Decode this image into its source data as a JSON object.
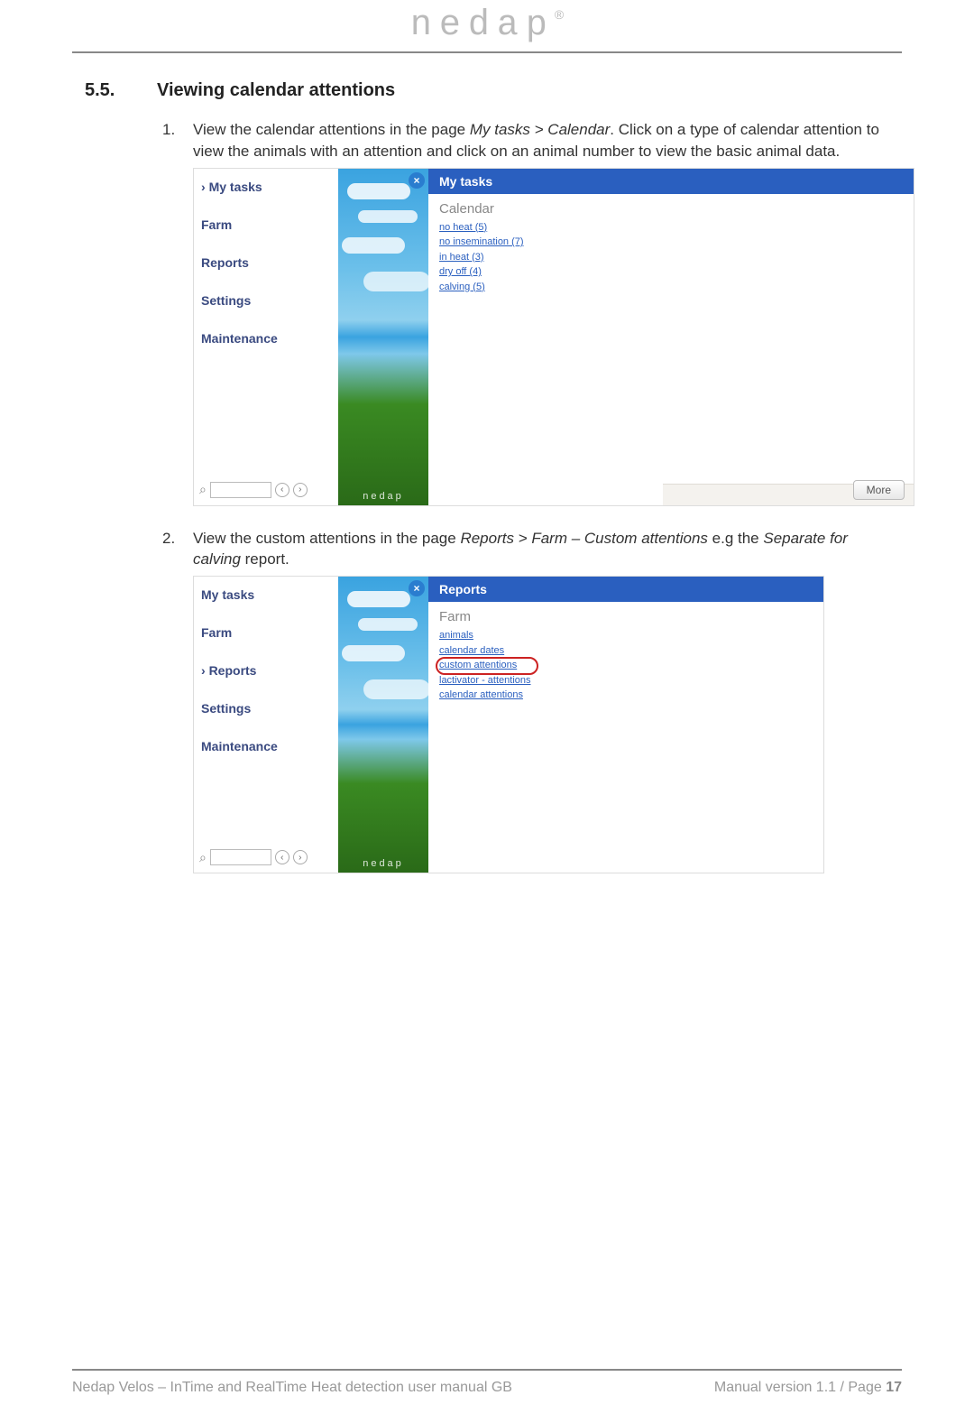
{
  "header": {
    "brand": "nedap",
    "registered": "®"
  },
  "section": {
    "number": "5.5.",
    "title": "Viewing calendar attentions"
  },
  "step1": {
    "number": "1.",
    "pre": "View the calendar attentions in the page ",
    "italic": "My tasks > Calendar",
    "post": ". Click on a type of calendar attention to view the animals with an attention and click on an animal number to view the basic animal data."
  },
  "step2": {
    "number": "2.",
    "pre": "View the custom attentions in the page ",
    "italic1": "Reports > Farm – Custom attentions",
    "mid": " e.g the ",
    "italic2": "Separate for calving",
    "post": " report."
  },
  "nav": {
    "my_tasks": "My tasks",
    "farm": "Farm",
    "reports": "Reports",
    "settings": "Settings",
    "maintenance": "Maintenance"
  },
  "figA": {
    "close": "×",
    "header": "My tasks",
    "group": "Calendar",
    "links": {
      "l1": "no heat (5)",
      "l2": "no insemination (7)",
      "l3": "in heat (3)",
      "l4": "dry off (4)",
      "l5": "calving (5)"
    },
    "more": "More",
    "brand": "nedap"
  },
  "figB": {
    "close": "×",
    "header": "Reports",
    "group": "Farm",
    "links": {
      "l1": "animals",
      "l2": "calendar dates",
      "l3": "custom attentions",
      "l4": "lactivator - attentions",
      "l5": "calendar attentions"
    },
    "brand": "nedap"
  },
  "search": {
    "icon": "⌕",
    "left": "‹",
    "right": "›"
  },
  "footer": {
    "left": "Nedap Velos – InTime and RealTime Heat detection user manual GB",
    "right_pre": "Manual version 1.1 / Page ",
    "page": "17"
  }
}
